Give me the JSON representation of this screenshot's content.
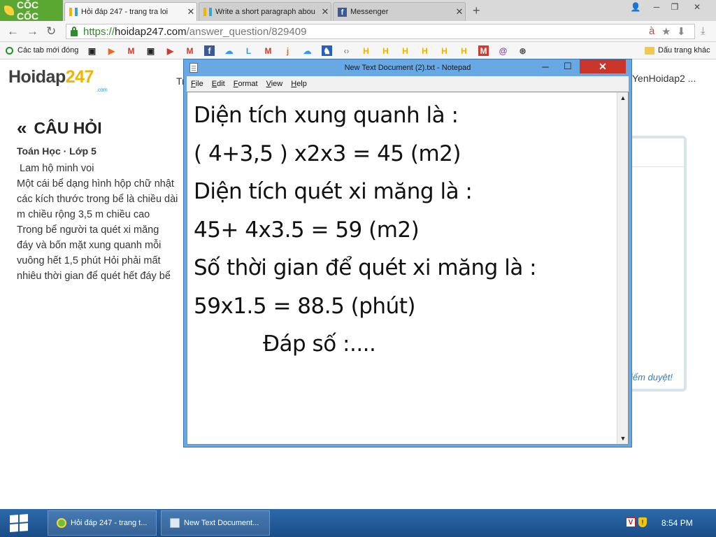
{
  "browser": {
    "brand": "CỐC CỐC",
    "tabs": [
      {
        "label": "Hỏi đáp 247 - trang tra loi",
        "active": true
      },
      {
        "label": "Write a short paragraph abou",
        "active": false
      },
      {
        "label": "Messenger",
        "active": false
      }
    ],
    "url": {
      "scheme": "https://",
      "host": "hoidap247.com",
      "path": "/answer_question/829409"
    },
    "bookmarks": {
      "new_tabs": "Các tab mới đóng",
      "folder": "Dấu trang khác"
    }
  },
  "page": {
    "logo_main": "Hoidap",
    "logo_accent": "247",
    "logo_suffix": ".com",
    "nav_initial": "Tr",
    "username": "YenHoidap2 ...",
    "section_title": "CÂU HỎI",
    "meta": "Toán Học · Lớp 5",
    "question_title": " Lam hộ minh voi",
    "question_lines": [
      "Một cái bể dạng hình hộp chữ nhật",
      "các kích thước trong bể là chiều dài",
      "m chiều rộng 3,5 m chiều cao",
      "Trong bể người ta quét xi măng",
      "đáy và bốn mặt xung quanh mỗi",
      "vuông hết 1,5 phút Hỏi phải mất",
      "nhiêu thời gian để quét hết đáy bể"
    ],
    "side_status": "iểm duyệt!"
  },
  "notepad": {
    "title": "New Text Document (2).txt - Notepad",
    "menu": [
      "File",
      "Edit",
      "Format",
      "View",
      "Help"
    ],
    "lines": [
      "Diện tích xung quanh là :",
      "( 4+3,5 ) x2x3 = 45 (m2)",
      "Diện tích quét xi măng là :",
      "45+ 4x3.5 = 59 (m2)",
      "Số thời gian để quét xi măng là :",
      "59x1.5 = 88.5 (phút)",
      "Đáp số :...."
    ]
  },
  "taskbar": {
    "items": [
      "Hỏi đáp 247 - trang t...",
      "New Text Document..."
    ],
    "time": "8:54 PM"
  },
  "colors": {
    "titlebar": "#68a8e4",
    "close": "#c9352b",
    "taskbar": "#1b4f8a",
    "brand_green": "#5aa832",
    "accent": "#f1b400"
  }
}
